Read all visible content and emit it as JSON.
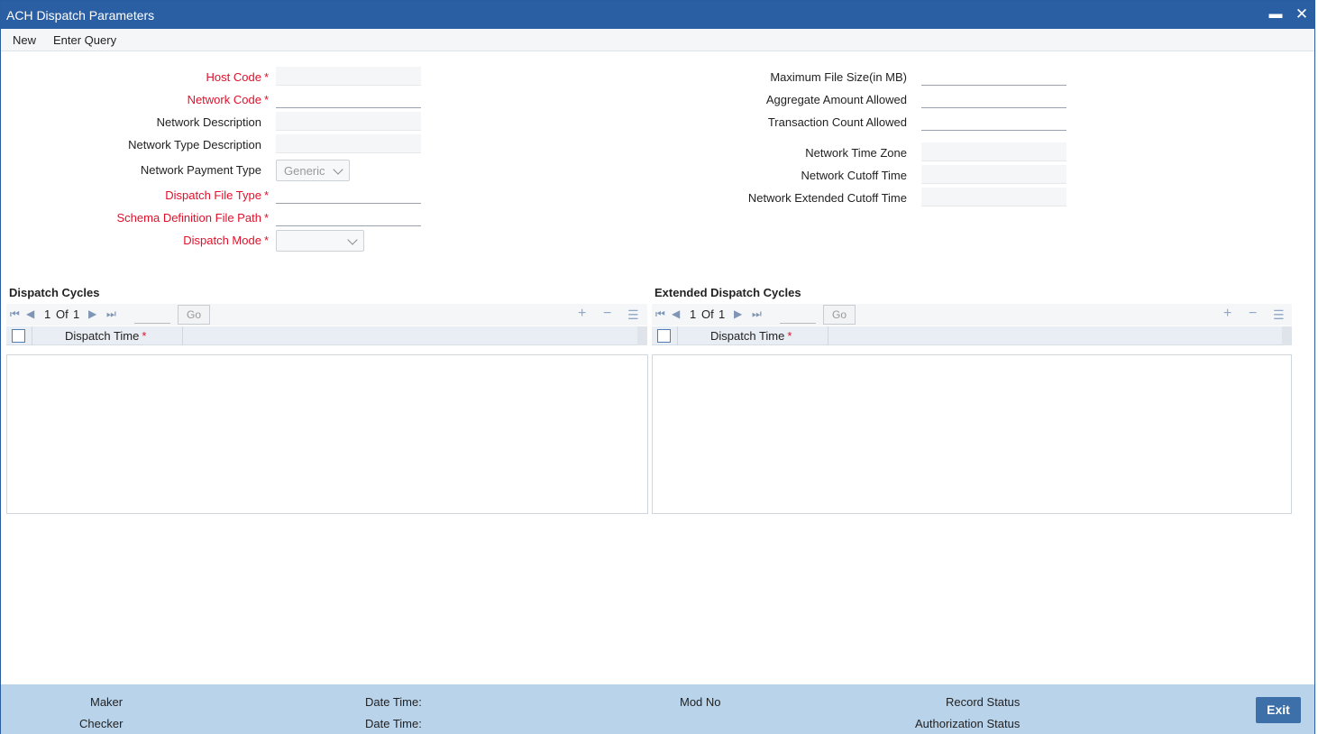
{
  "window": {
    "title": "ACH Dispatch Parameters",
    "minimize_glyph": "▬",
    "close_glyph": "✕"
  },
  "menu": {
    "new": "New",
    "enter_query": "Enter Query"
  },
  "form_left": {
    "host_code": "Host Code",
    "network_code": "Network Code",
    "network_description": "Network Description",
    "network_type_description": "Network Type Description",
    "network_payment_type": "Network Payment Type",
    "network_payment_type_value": "Generic",
    "dispatch_file_type": "Dispatch File Type",
    "schema_definition_file_path": "Schema Definition File Path",
    "dispatch_mode": "Dispatch Mode",
    "required_mark": "*"
  },
  "form_right": {
    "maximum_file_size": "Maximum File Size(in MB)",
    "aggregate_amount_allowed": "Aggregate Amount Allowed",
    "transaction_count_allowed": "Transaction Count Allowed",
    "network_time_zone": "Network Time Zone",
    "network_cutoff_time": "Network Cutoff Time",
    "network_extended_cutoff_time": "Network Extended Cutoff Time"
  },
  "dispatch_cycles": {
    "title": "Dispatch Cycles",
    "page": "1",
    "of": "Of",
    "total": "1",
    "go": "Go",
    "column": "Dispatch Time",
    "required_mark": "*"
  },
  "extended_dispatch_cycles": {
    "title": "Extended Dispatch Cycles",
    "page": "1",
    "of": "Of",
    "total": "1",
    "go": "Go",
    "column": "Dispatch Time",
    "required_mark": "*"
  },
  "footer": {
    "maker": "Maker",
    "checker": "Checker",
    "date_time_1": "Date Time:",
    "date_time_2": "Date Time:",
    "mod_no": "Mod No",
    "record_status": "Record Status",
    "authorization_status": "Authorization Status",
    "exit": "Exit"
  },
  "colors": {
    "titlebar": "#2b5fa3",
    "required": "#e0102a",
    "footer": "#b9d3ea",
    "exit_button": "#3d6fa8"
  }
}
